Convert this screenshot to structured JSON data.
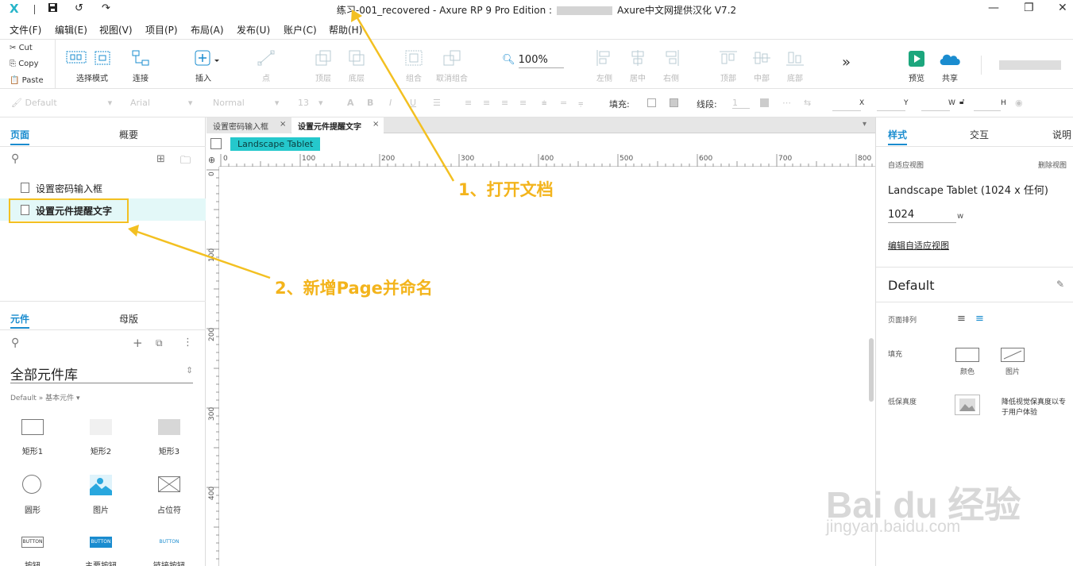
{
  "titlebar": {
    "logo": "X",
    "title_prefix": "练习-001_recovered - Axure RP 9 Pro Edition :",
    "title_suffix": "Axure中文网提供汉化 V7.2"
  },
  "menu": [
    "文件(F)",
    "编辑(E)",
    "视图(V)",
    "项目(P)",
    "布局(A)",
    "发布(U)",
    "账户(C)",
    "帮助(H)"
  ],
  "clipboard": {
    "cut": "Cut",
    "copy": "Copy",
    "paste": "Paste"
  },
  "toolbar": {
    "select_mode": "选择模式",
    "connect": "连接",
    "insert": "插入",
    "point": "点",
    "top_layer": "顶层",
    "bottom_layer": "底层",
    "group": "组合",
    "ungroup": "取消组合",
    "left": "左侧",
    "center": "居中",
    "right": "右侧",
    "top": "顶部",
    "middle": "中部",
    "bottom": "底部",
    "zoom": "100%",
    "more": "»",
    "preview": "预览",
    "share": "共享"
  },
  "formatbar": {
    "style": "Default",
    "font": "Arial",
    "weight": "Normal",
    "size": "13",
    "fill_label": "填充:",
    "stroke_label": "线段:",
    "stroke_value": "1",
    "x": "X",
    "y": "Y",
    "w": "W",
    "h": "H"
  },
  "left_panel": {
    "tab_pages": "页面",
    "tab_outline": "概要",
    "pages": [
      "设置密码输入框",
      "设置元件提醒文字"
    ],
    "tab_widgets": "元件",
    "tab_masters": "母版",
    "library_name": "全部元件库",
    "library_breadcrumb": "Default » 基本元件 ▾",
    "widgets": [
      "矩形1",
      "矩形2",
      "矩形3",
      "圆形",
      "图片",
      "占位符",
      "按钮",
      "主要按钮",
      "链接按钮"
    ],
    "button_text": "BUTTON"
  },
  "canvas": {
    "tabs": [
      "设置密码输入框",
      "设置元件提醒文字"
    ],
    "view_badge": "Landscape Tablet",
    "ruler_h": [
      "0",
      "100",
      "200",
      "300",
      "400",
      "500",
      "600",
      "700",
      "800"
    ],
    "ruler_v": [
      "0",
      "100",
      "200",
      "300",
      "400"
    ]
  },
  "right_panel": {
    "tab_style": "样式",
    "tab_interaction": "交互",
    "tab_notes": "说明",
    "adaptive_label": "自适应视图",
    "delete_view": "删除视图",
    "view_name": "Landscape Tablet (1024 x 任何)",
    "width_value": "1024",
    "width_unit": "w",
    "edit_adaptive": "编辑自适应视图",
    "style_name": "Default",
    "page_align": "页面排列",
    "fill": "填充",
    "fill_color": "颜色",
    "fill_image": "图片",
    "low_fidelity": "低保真度",
    "low_fidelity_desc_1": "降低视觉保真度以专",
    "low_fidelity_desc_2": "于用户体验"
  },
  "annotations": {
    "step1": "1、打开文档",
    "step2": "2、新增Page并命名",
    "color": "#f3b41c"
  },
  "watermark": {
    "logo": "Bai du 经验",
    "url": "jingyan.baidu.com"
  }
}
